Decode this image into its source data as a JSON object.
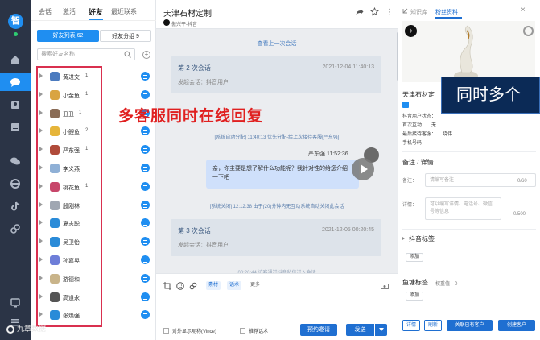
{
  "app": {
    "logo_char": "智"
  },
  "rail": {
    "items": [
      "home-icon",
      "chat-icon",
      "contacts-icon",
      "document-icon",
      "wechat-icon",
      "browser-icon",
      "douyin-icon",
      "link-icon",
      "monitor-icon",
      "expand-icon"
    ],
    "active": "chat-icon"
  },
  "friends": {
    "tabs": [
      "会话",
      "激活",
      "好友",
      "最近联系"
    ],
    "active_tab": "好友",
    "segments": {
      "list": "好友列表 62",
      "groups": "好友分组 9"
    },
    "search_placeholder": "搜索好友名称",
    "rows": [
      {
        "name": "黄进文",
        "count": "1",
        "avatar_color": "#4b7bbf"
      },
      {
        "name": "小金鱼",
        "count": "1",
        "avatar_color": "#d9a441"
      },
      {
        "name": "丑丑",
        "count": "1",
        "avatar_color": "#8a6c56"
      },
      {
        "name": "小鲤鱼",
        "count": "2",
        "avatar_color": "#e6b53a"
      },
      {
        "name": "严东强",
        "count": "1",
        "avatar_color": "#b04b3a"
      },
      {
        "name": "李义燕",
        "count": "",
        "avatar_color": "#8fb0d6"
      },
      {
        "name": "桃花鱼",
        "count": "1",
        "avatar_color": "#c7466a"
      },
      {
        "name": "殷刚林",
        "count": "",
        "avatar_color": "#a0a7b2"
      },
      {
        "name": "夏志聪",
        "count": "",
        "avatar_color": "#2a8bd8"
      },
      {
        "name": "吴卫怡",
        "count": "",
        "avatar_color": "#2a8bd8"
      },
      {
        "name": "孙嘉晃",
        "count": "",
        "avatar_color": "#6e7ed8"
      },
      {
        "name": "游德和",
        "count": "",
        "avatar_color": "#c9b48a"
      },
      {
        "name": "高道永",
        "count": "",
        "avatar_color": "#555555"
      },
      {
        "name": "张焕强",
        "count": "",
        "avatar_color": "#2a8bd8"
      }
    ]
  },
  "overlay_text": "多客服同时在线回复",
  "chat": {
    "title": "天津石材定制",
    "subtitle": "傲兴平-抖音",
    "load_more": "查看上一次会话",
    "sessions": [
      {
        "name": "第 2 次会话",
        "time": "2021-12-04 11:40:13",
        "from": "发起会话：抖音用户"
      },
      {
        "name": "第 3 次会话",
        "time": "2021-12-05 00:20:45",
        "from": "发起会话：抖音用户"
      }
    ],
    "system_messages": [
      "[系统自动分配] 11:40:13 优先分配-给上次接待客服[严东强]",
      "[系统关闭] 12:12:38 由于(20)分钟内无互动系统自动关闭此会话"
    ],
    "agent_name_time": "严东强 11:52:36",
    "message": "亲，你主要是想了解什么功能呢？我针对性的给您介绍一下吧",
    "tail_note": "00:20:44 访客通过抖音私信进入会话",
    "toolbar": {
      "material": "素材",
      "script": "话术",
      "more": "更多"
    },
    "checkbox_nickname": "对外显示昵称(Vince)",
    "checkbox_recommend": "推荐话术",
    "invite_button": "预约邀请",
    "send_button": "发送"
  },
  "panel": {
    "tabs": [
      "知识库",
      "粉丝资料"
    ],
    "active_tab": "粉丝资料",
    "name": "天津石材定",
    "banner": "同时多个",
    "fields": [
      {
        "label": "抖音用户状态：",
        "value": ""
      },
      {
        "label": "首次互动：",
        "value": "无"
      },
      {
        "label": "最后接待客服：",
        "value": "烧伟"
      },
      {
        "label": "手机号码：",
        "value": ""
      }
    ],
    "notes_section": "备注 / 详情",
    "note_label": "备注：",
    "note_placeholder": "请编写备注",
    "note_count": "0/60",
    "detail_label": "详情：",
    "detail_placeholder": "可以编写详情、电话号、微信号等信息",
    "detail_count": "0/500",
    "douyin_tags": "抖音标签",
    "add_label": "添加",
    "fishpond_tags": "鱼塘标签",
    "fishpond_weight": "权重值：0",
    "buttons": {
      "detail": "详情",
      "refresh": "刷新",
      "link": "关联已有客户",
      "create": "创建客户"
    }
  },
  "watermark": "九章数据"
}
